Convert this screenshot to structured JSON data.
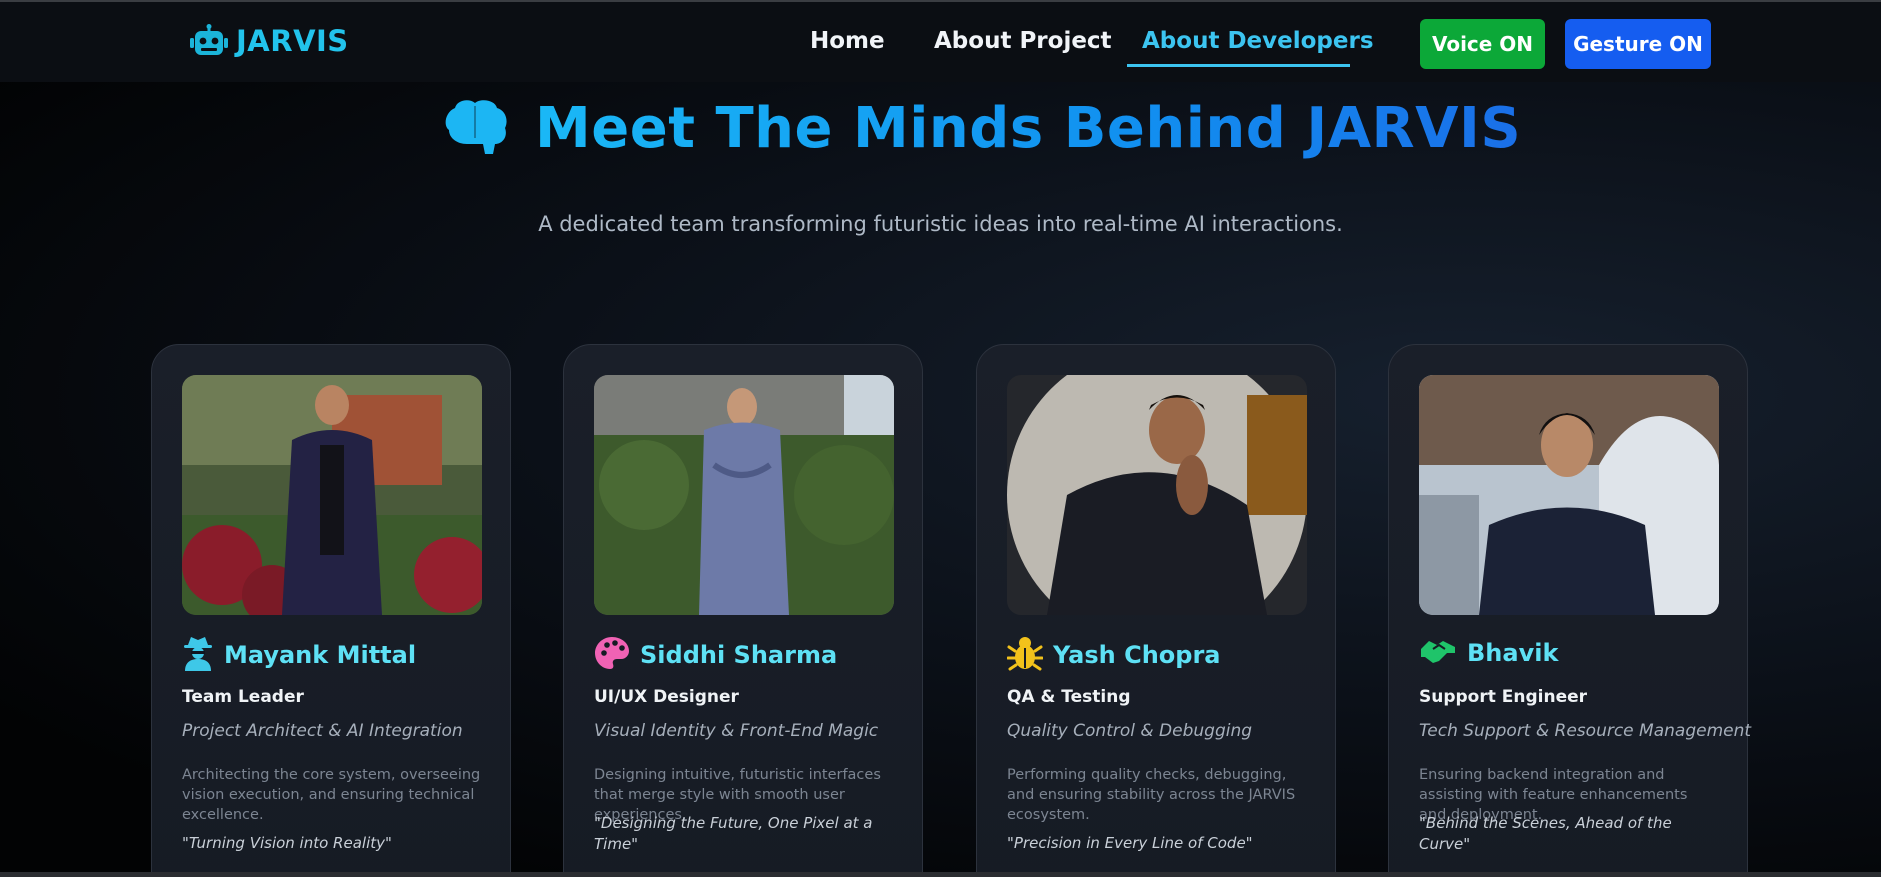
{
  "navbar": {
    "brand": "JARVIS",
    "brand_icon": "robot-icon",
    "links": [
      "Home",
      "About Project",
      "About Developers"
    ],
    "active_link": "About Developers",
    "voice_button": "Voice ON",
    "gesture_button": "Gesture ON"
  },
  "hero": {
    "icon": "brain-icon",
    "title": "Meet The Minds Behind JARVIS",
    "subtitle": "A dedicated team transforming futuristic ideas into real-time AI interactions."
  },
  "team": [
    {
      "name": "Mayank Mittal",
      "icon": "user-secret-icon",
      "role": "Team Leader",
      "focus": "Project Architect & AI Integration",
      "description": "Architecting the core system, overseeing vision execution, and ensuring technical excellence.",
      "quote": "\"Turning Vision into Reality\""
    },
    {
      "name": "Siddhi Sharma",
      "icon": "palette-icon",
      "role": "UI/UX Designer",
      "focus": "Visual Identity & Front-End Magic",
      "description": "Designing intuitive, futuristic interfaces that merge style with smooth user experiences.",
      "quote": "\"Designing the Future, One Pixel at a Time\""
    },
    {
      "name": "Yash Chopra",
      "icon": "bug-icon",
      "role": "QA & Testing",
      "focus": "Quality Control & Debugging",
      "description": "Performing quality checks, debugging, and ensuring stability across the JARVIS ecosystem.",
      "quote": "\"Precision in Every Line of Code\""
    },
    {
      "name": "Bhavik",
      "icon": "handshake-icon",
      "role": "Support Engineer",
      "focus": "Tech Support & Resource Management",
      "description": "Ensuring backend integration and assisting with feature enhancements and deployment.",
      "quote": "\"Behind the Scenes, Ahead of the Curve\""
    }
  ],
  "colors": {
    "accent": "#22c3ec",
    "name": "#5ee1f5",
    "voice_button": "#0ca838",
    "gesture_button": "#155df0"
  }
}
